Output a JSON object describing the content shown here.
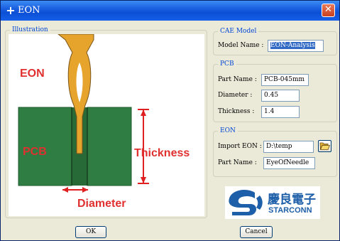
{
  "window": {
    "title": "EON",
    "close_glyph": "✕"
  },
  "illustration": {
    "group_title": "Illustration",
    "labels": {
      "eon": "EON",
      "pcb": "PCB",
      "thickness": "Thickness",
      "diameter": "Diameter"
    },
    "colors": {
      "label_red": "#e03030",
      "board": "#2f7d42",
      "pin": "#e6a42c",
      "dimension": "#e02020"
    }
  },
  "cae_model": {
    "group_title": "CAE Model",
    "model_name_label": "Model Name :",
    "model_name_value": "EON-Analysis"
  },
  "pcb": {
    "group_title": "PCB",
    "part_name_label": "Part Name :",
    "part_name_value": "PCB-045mm",
    "diameter_label": "Diameter :",
    "diameter_value": "0.45",
    "thickness_label": "Thickness :",
    "thickness_value": "1.4"
  },
  "eon": {
    "group_title": "EON",
    "import_label": "Import EON :",
    "import_value": "D:\\temp",
    "browse_icon": "folder-open-icon",
    "part_name_label": "Part Name :",
    "part_name_value": "EyeOfNeedle"
  },
  "logo": {
    "chinese": "慶良電子",
    "english": "STARCONN",
    "color": "#1d5fa8"
  },
  "buttons": {
    "ok": "OK",
    "cancel": "Cancel"
  }
}
